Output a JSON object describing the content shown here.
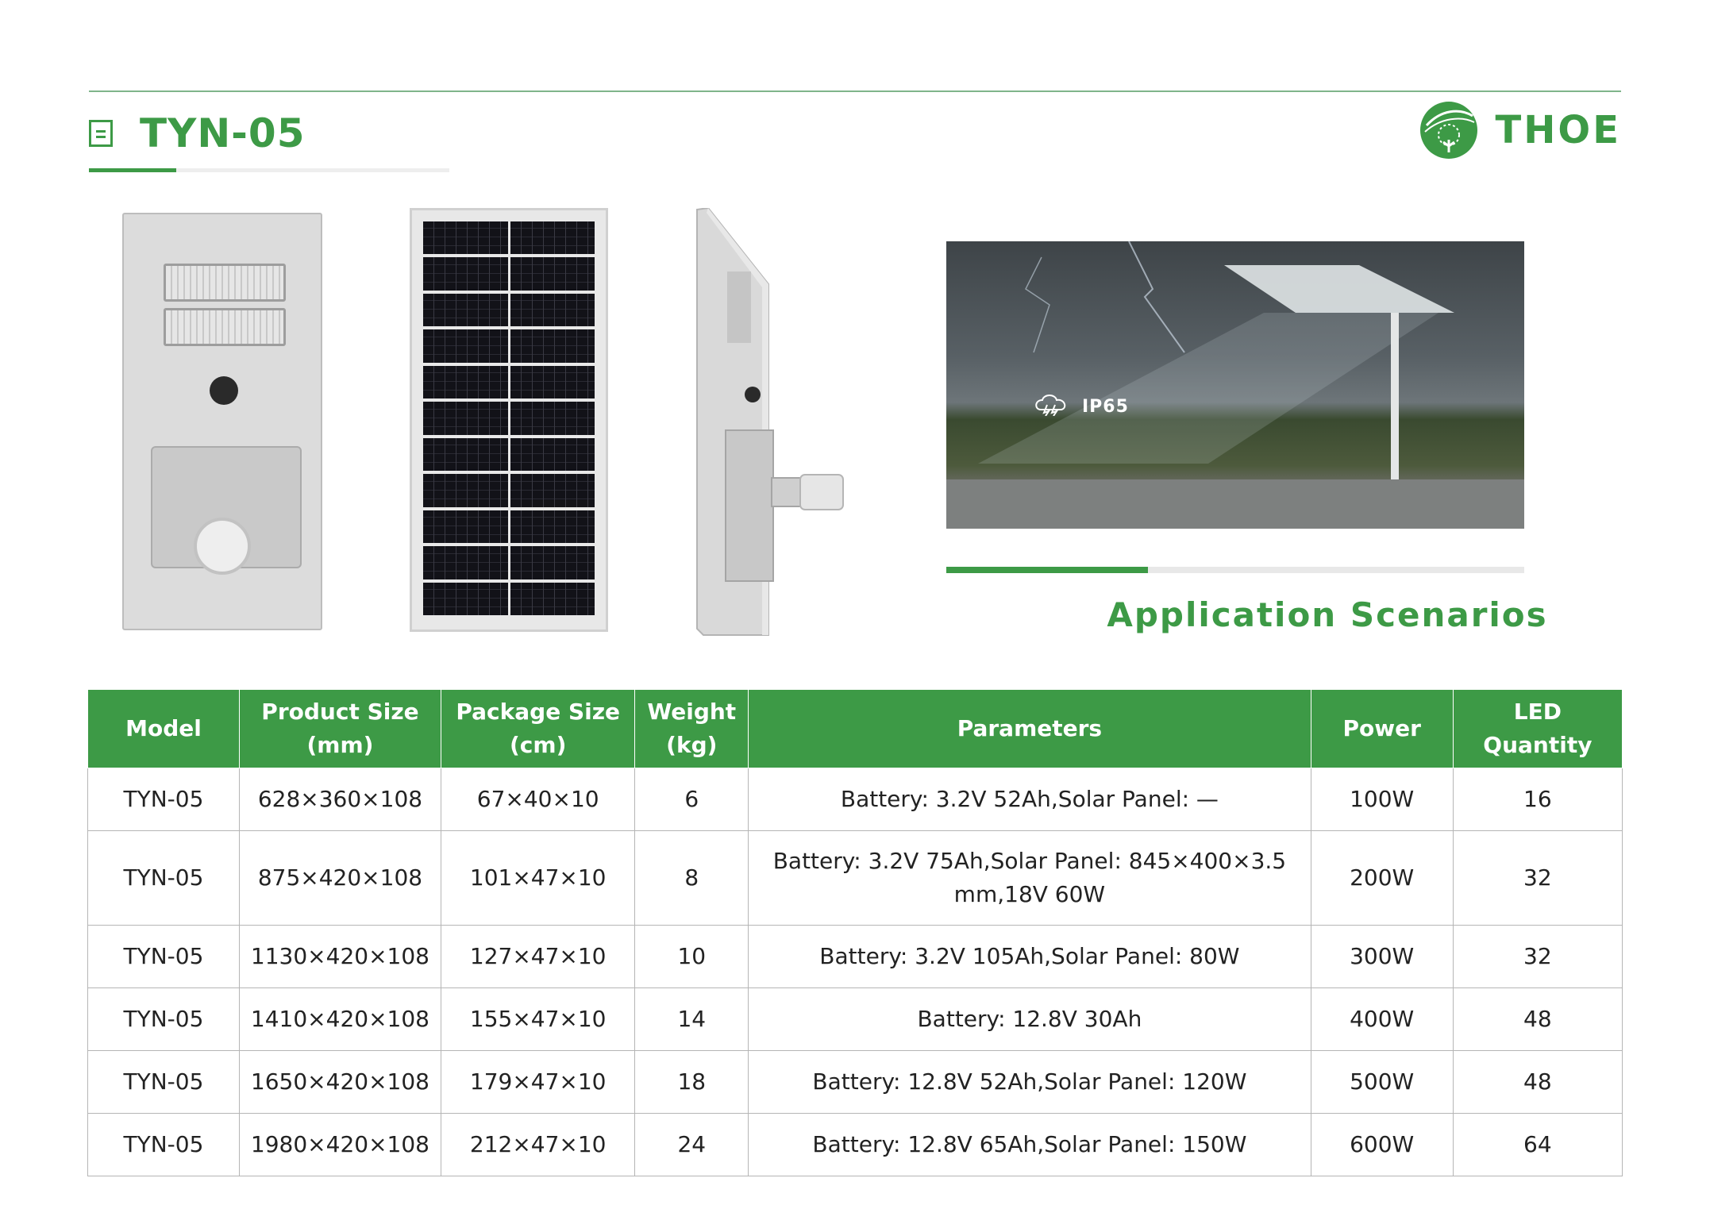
{
  "header": {
    "title": "TYN-05",
    "brand": "THOE"
  },
  "images": {
    "front_view": "street-light-front-view",
    "solar_panel_view": "solar-panel-back-view",
    "side_view": "street-light-side-view",
    "scene_label": "IP65"
  },
  "scenario": {
    "title": "Application Scenarios"
  },
  "table": {
    "headers": [
      {
        "line1": "Model",
        "line2": ""
      },
      {
        "line1": "Product Size",
        "line2": "(mm)"
      },
      {
        "line1": "Package Size",
        "line2": "(cm)"
      },
      {
        "line1": "Weight",
        "line2": "(kg)"
      },
      {
        "line1": "Parameters",
        "line2": ""
      },
      {
        "line1": "Power",
        "line2": ""
      },
      {
        "line1": "LED Quantity",
        "line2": ""
      }
    ],
    "rows": [
      [
        "TYN-05",
        "628×360×108",
        "67×40×10",
        "6",
        "Battery: 3.2V 52Ah,Solar Panel: —",
        "",
        "100W",
        "16"
      ],
      [
        "TYN-05",
        "875×420×108",
        "101×47×10",
        "8",
        "Battery: 3.2V 75Ah,Solar Panel: 845×400×3.5",
        "mm,18V 60W",
        "200W",
        "32"
      ],
      [
        "TYN-05",
        "1130×420×108",
        "127×47×10",
        "10",
        "Battery: 3.2V 105Ah,Solar Panel: 80W",
        "",
        "300W",
        "32"
      ],
      [
        "TYN-05",
        "1410×420×108",
        "155×47×10",
        "14",
        "Battery: 12.8V 30Ah",
        "",
        "400W",
        "48"
      ],
      [
        "TYN-05",
        "1650×420×108",
        "179×47×10",
        "18",
        "Battery: 12.8V 52Ah,Solar Panel: 120W",
        "",
        "500W",
        "48"
      ],
      [
        "TYN-05",
        "1980×420×108",
        "212×47×10",
        "24",
        "Battery: 12.8V 65Ah,Solar Panel: 150W",
        "",
        "600W",
        "64"
      ]
    ]
  }
}
